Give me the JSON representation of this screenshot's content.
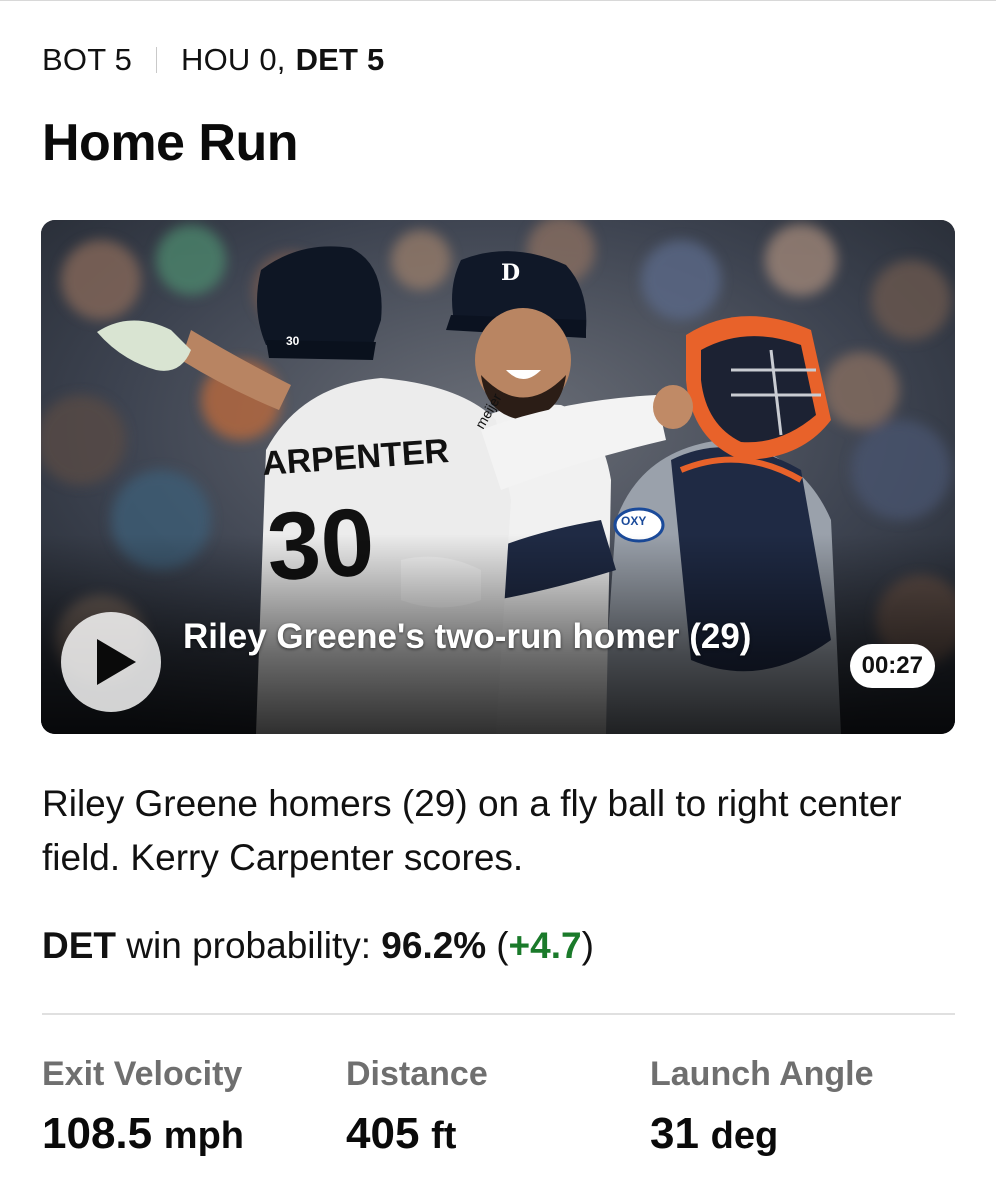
{
  "header": {
    "inning": "BOT 5",
    "away_score": "HOU 0,",
    "home_score": "DET 5"
  },
  "title": "Home Run",
  "video": {
    "caption": "Riley Greene's two-run homer (29)",
    "duration": "00:27",
    "play_icon": "play-icon"
  },
  "description": "Riley Greene homers (29) on a fly ball to right center field. Kerry Carpenter scores.",
  "win_probability": {
    "team": "DET",
    "label": "win probability:",
    "value": "96.2%",
    "delta_open": "(",
    "delta": "+4.7",
    "delta_close": ")",
    "delta_color": "#1a7a2a"
  },
  "stats": [
    {
      "label": "Exit Velocity",
      "value": "108.5",
      "unit": "mph"
    },
    {
      "label": "Distance",
      "value": "405",
      "unit": "ft"
    },
    {
      "label": "Launch Angle",
      "value": "31",
      "unit": "deg"
    }
  ],
  "photo_text": {
    "jersey_name": "ARPENTER",
    "jersey_number": "30",
    "helmet_number": "30",
    "sleeve_patch": "meijer",
    "chest_logo": "D",
    "catcher_patch": "OXY"
  }
}
